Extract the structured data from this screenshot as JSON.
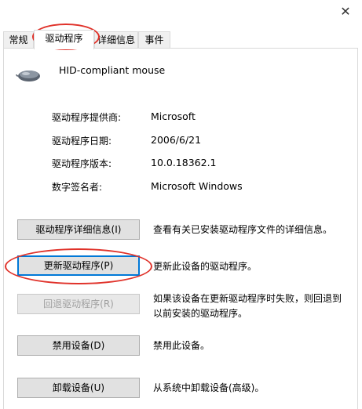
{
  "window": {
    "title": "",
    "close_glyph": "✕"
  },
  "tabs": [
    {
      "label": "常规"
    },
    {
      "label": "驱动程序"
    },
    {
      "label": "详细信息"
    },
    {
      "label": "事件"
    }
  ],
  "device": {
    "name": "HID-compliant mouse",
    "icon": "mouse-icon"
  },
  "properties": [
    {
      "label": "驱动程序提供商:",
      "value": "Microsoft"
    },
    {
      "label": "驱动程序日期:",
      "value": "2006/6/21"
    },
    {
      "label": "驱动程序版本:",
      "value": "10.0.18362.1"
    },
    {
      "label": "数字签名者:",
      "value": "Microsoft Windows"
    }
  ],
  "actions": [
    {
      "label": "驱动程序详细信息(I)",
      "description": "查看有关已安装驱动程序文件的详细信息。"
    },
    {
      "label": "更新驱动程序(P)",
      "description": "更新此设备的驱动程序。"
    },
    {
      "label": "回退驱动程序(R)",
      "description": "如果该设备在更新驱动程序时失败，则回退到以前安装的驱动程序。"
    },
    {
      "label": "禁用设备(D)",
      "description": "禁用此设备。"
    },
    {
      "label": "卸载设备(U)",
      "description": "从系统中卸载设备(高级)。"
    }
  ],
  "colors": {
    "annotation": "#e0322a",
    "focus": "#0078d7"
  }
}
